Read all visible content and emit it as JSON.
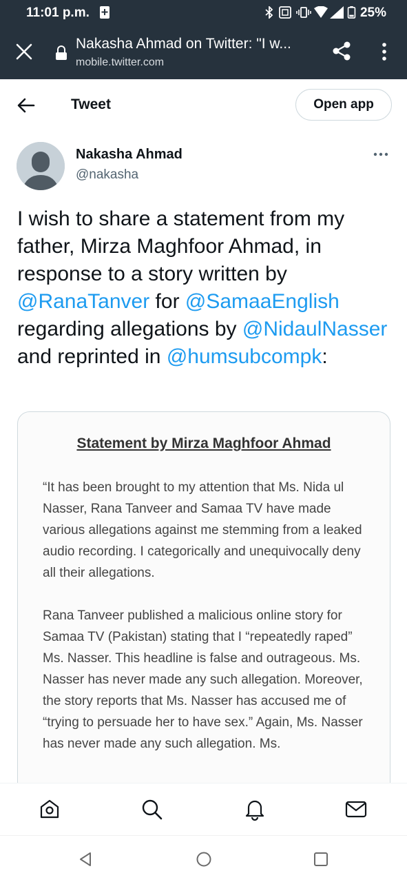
{
  "status_bar": {
    "time": "11:01 p.m.",
    "battery": "25%"
  },
  "browser": {
    "page_title": "Nakasha Ahmad on Twitter: \"I w...",
    "url": "mobile.twitter.com"
  },
  "header": {
    "title": "Tweet",
    "open_app_label": "Open app"
  },
  "tweet": {
    "author_name": "Nakasha Ahmad",
    "author_handle": "@nakasha",
    "text_1": "I wish to share a statement from my father, Mirza Maghfoor Ahmad, in response to a story written by ",
    "mention_1": "@RanaTanver",
    "text_2": " for ",
    "mention_2": "@SamaaEnglish",
    "text_3": " regarding allegations by ",
    "mention_3": "@NidaulNasser",
    "text_4": " and reprinted in ",
    "mention_4": "@humsubcompk",
    "text_5": ":"
  },
  "media": {
    "title": "Statement by Mirza Maghfoor Ahmad",
    "paragraph_1": "“It has been brought to my attention that Ms. Nida ul Nasser, Rana Tanveer and Samaa TV have made various allegations against me stemming from a leaked audio recording. I categorically and unequivocally deny all their allegations.",
    "paragraph_2": "Rana Tanveer published a malicious online story for Samaa TV (Pakistan) stating that I “repeatedly raped” Ms. Nasser. This headline is false and outrageous.  Ms. Nasser has never made any such allegation. Moreover, the story reports that Ms. Nasser has accused me of “trying to persuade her to have sex.”  Again, Ms. Nasser has never made any such allegation. Ms."
  },
  "bottom_nav": {
    "icons": [
      "home-icon",
      "search-icon",
      "notifications-icon",
      "messages-icon"
    ]
  },
  "colors": {
    "chrome_bg": "#26323d",
    "link_blue": "#1d9bf0",
    "text_primary": "#0f1419",
    "text_secondary": "#536471"
  }
}
